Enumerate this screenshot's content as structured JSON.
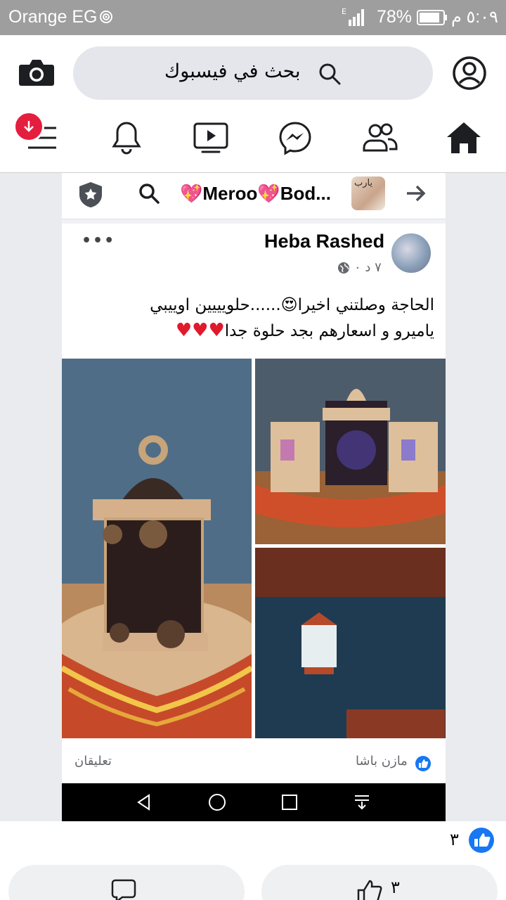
{
  "status_bar": {
    "carrier": "Orange EG",
    "battery_percent": "78%",
    "time": "٥:٠٩ م",
    "network_type": "E",
    "icons": [
      "hotspot-icon",
      "signal-icon",
      "battery-icon"
    ]
  },
  "header": {
    "search_placeholder": "بحث في فيسبوك",
    "icons": [
      "camera-icon",
      "search-icon",
      "profile-icon"
    ]
  },
  "nav_tabs": [
    {
      "name": "home",
      "icon": "home-icon",
      "active": true
    },
    {
      "name": "friends",
      "icon": "friends-icon"
    },
    {
      "name": "messenger",
      "icon": "messenger-icon"
    },
    {
      "name": "watch",
      "icon": "video-icon"
    },
    {
      "name": "notifications",
      "icon": "bell-icon"
    },
    {
      "name": "menu",
      "icon": "menu-icon",
      "badge": "download-icon"
    }
  ],
  "embedded_screenshot": {
    "top_bar": {
      "chat_name": "💖Meroo💖Bod...",
      "thumb_text": "يارب",
      "icons": [
        "shield-icon",
        "search-icon",
        "arrow-right-icon"
      ]
    },
    "post": {
      "author": "Heba Rashed",
      "time": "٧ د ٠",
      "privacy_icon": "globe-icon",
      "text_line1": "الحاجة وصلتني اخيرا😍......حلويييين اوييبي",
      "text_line2": "ياميرو و اسعارهم بجد حلوة جدا",
      "hearts": "♥♥♥",
      "footer_liker": "مازن باشا",
      "footer_comments": "تعليقان"
    }
  },
  "reactions": {
    "like_count": "٣"
  },
  "actions": {
    "like_count": "٣"
  },
  "colors": {
    "facebook_blue": "#1877f2",
    "badge_red": "#e41e3f",
    "heart_red": "#e0192c",
    "status_bar_gray": "#9e9e9e"
  }
}
